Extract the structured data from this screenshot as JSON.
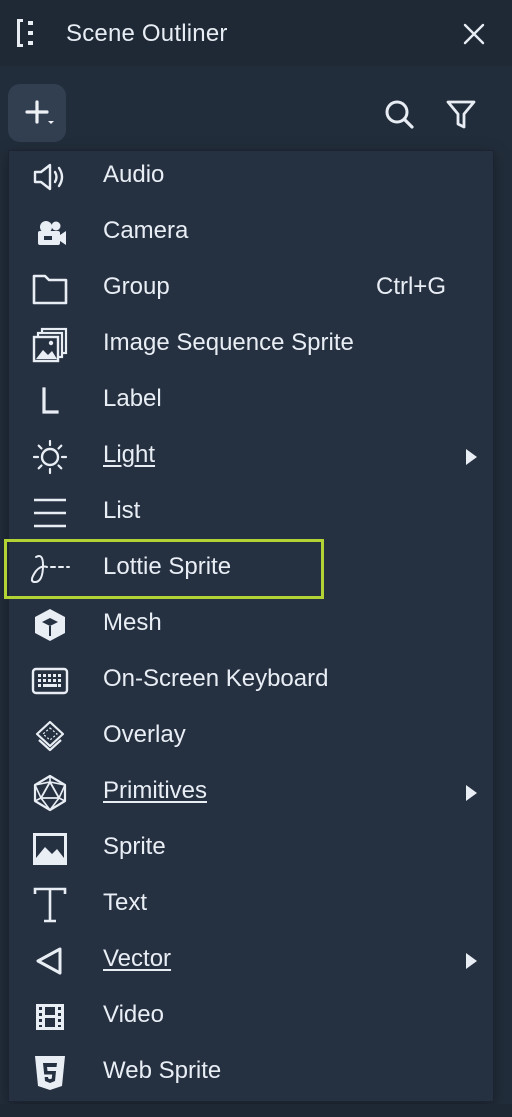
{
  "window": {
    "title": "Scene Outliner",
    "drag_icon": "drag-handle-icon",
    "close_icon": "close-icon"
  },
  "toolbar": {
    "add_icon": "add-dropdown-icon",
    "search_icon": "search-icon",
    "filter_icon": "filter-icon"
  },
  "menu": {
    "items": [
      {
        "label": "Audio",
        "icon": "speaker-icon"
      },
      {
        "label": "Camera",
        "icon": "camera-icon"
      },
      {
        "label": "Group",
        "icon": "folder-icon",
        "shortcut": "Ctrl+G"
      },
      {
        "label": "Image Sequence Sprite",
        "icon": "image-sequence-icon"
      },
      {
        "label": "Label",
        "icon": "label-icon"
      },
      {
        "label": "Light",
        "icon": "light-bulb-icon",
        "submenu": true
      },
      {
        "label": "List",
        "icon": "list-icon"
      },
      {
        "label": "Lottie Sprite",
        "icon": "lottie-icon",
        "highlighted": true
      },
      {
        "label": "Mesh",
        "icon": "cube-icon"
      },
      {
        "label": "On-Screen Keyboard",
        "icon": "keyboard-icon"
      },
      {
        "label": "Overlay",
        "icon": "overlay-icon"
      },
      {
        "label": "Primitives",
        "icon": "polyhedron-icon",
        "submenu": true
      },
      {
        "label": "Sprite",
        "icon": "picture-icon"
      },
      {
        "label": "Text",
        "icon": "text-icon"
      },
      {
        "label": "Vector",
        "icon": "vector-icon",
        "submenu": true
      },
      {
        "label": "Video",
        "icon": "film-icon"
      },
      {
        "label": "Web Sprite",
        "icon": "html5-icon"
      }
    ]
  },
  "colors": {
    "background": "#222d3b",
    "menu_background": "#253040",
    "highlight": "#b3d334",
    "text": "#e9eef5"
  }
}
